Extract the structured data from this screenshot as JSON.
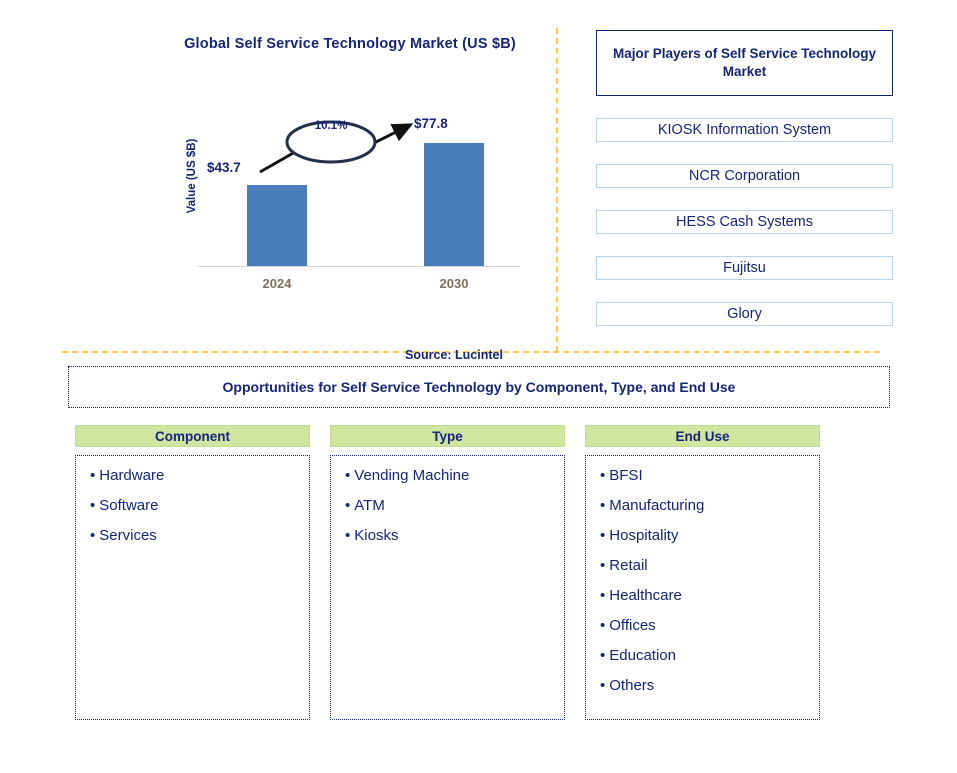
{
  "chart_panel": {
    "title": "Global Self Service Technology Market (US $B)",
    "y_axis_label": "Value (US $B)",
    "source": "Source: Lucintel",
    "cagr_label": "10.1%"
  },
  "chart_data": {
    "type": "bar",
    "title": "Global Self Service Technology Market (US $B)",
    "categories": [
      "2024",
      "2030"
    ],
    "values": [
      43.7,
      77.8
    ],
    "data_labels": [
      "$43.7",
      "$77.8"
    ],
    "xlabel": "",
    "ylabel": "Value (US $B)",
    "ylim": [
      0,
      90
    ],
    "grid": false,
    "legend": "none",
    "annotations": [
      {
        "text": "10.1%",
        "kind": "cagr-ellipse-arrow",
        "from_category": "2024",
        "to_category": "2030"
      }
    ],
    "series_color": "#4a7ebb",
    "source": "Source: Lucintel"
  },
  "players": {
    "header": "Major Players of Self Service Technology Market",
    "items": [
      "KIOSK Information System",
      "NCR Corporation",
      "HESS Cash Systems",
      "Fujitsu",
      "Glory"
    ]
  },
  "opportunities": {
    "banner": "Opportunities for Self Service Technology by Component, Type, and End Use",
    "columns": [
      {
        "header": "Component",
        "items": [
          "Hardware",
          "Software",
          "Services"
        ]
      },
      {
        "header": "Type",
        "items": [
          "Vending Machine",
          "ATM",
          "Kiosks"
        ]
      },
      {
        "header": "End Use",
        "items": [
          "BFSI",
          "Manufacturing",
          "Hospitality",
          "Retail",
          "Healthcare",
          "Offices",
          "Education",
          "Others"
        ]
      }
    ]
  },
  "colors": {
    "bar": "#4a7ebb",
    "navy_text": "#16257c",
    "divider": "#ffc845",
    "header_green": "#cfe5a0",
    "player_border": "#b8d4ea",
    "tick_label": "#7f6f5f"
  },
  "bullet": "•"
}
